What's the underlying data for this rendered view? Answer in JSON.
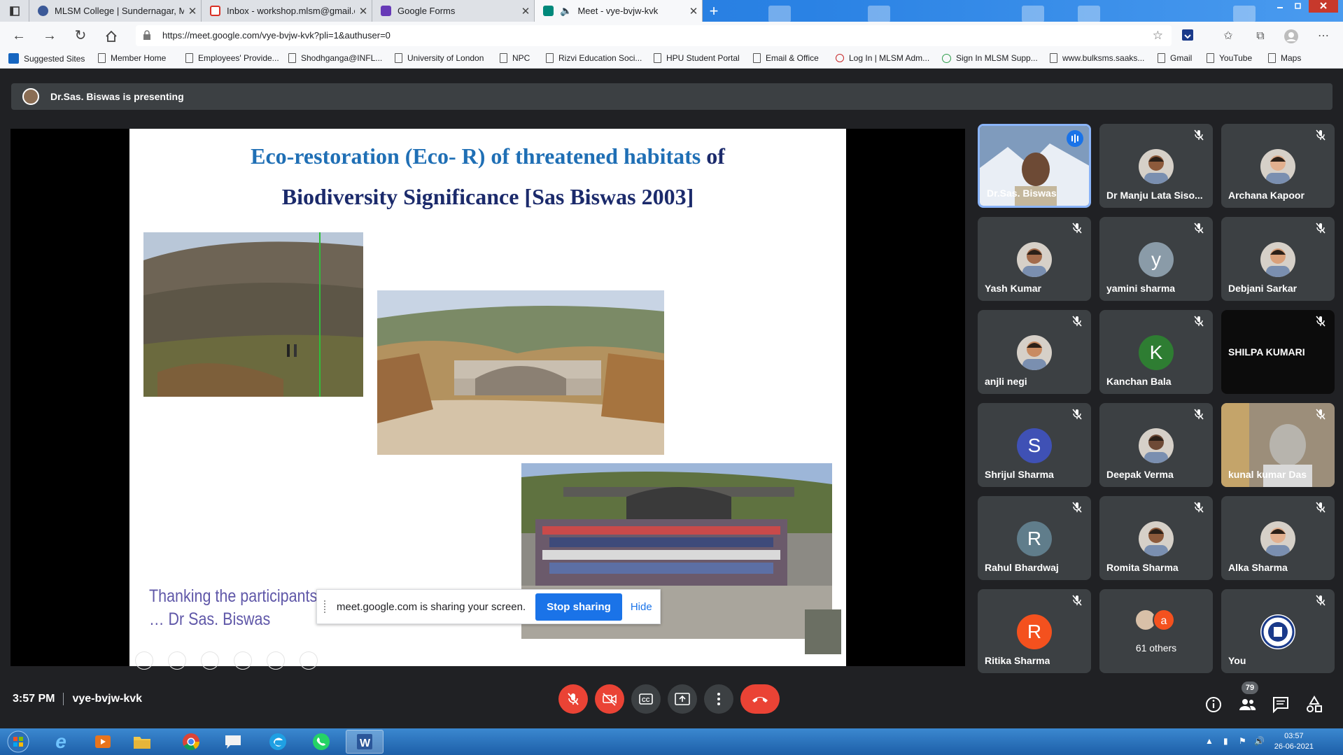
{
  "browser": {
    "tabs": [
      {
        "title": "MLSM College | Sundernagar, M",
        "icon_color": "#3b5998",
        "active": false
      },
      {
        "title": "Inbox - workshop.mlsm@gmail.c",
        "icon_color": "#d93025",
        "active": false
      },
      {
        "title": "Google Forms",
        "icon_color": "#673ab7",
        "active": false
      },
      {
        "title": "Meet - vye-bvjw-kvk",
        "icon_color": "#00897b",
        "active": true
      }
    ],
    "new_tab_glyph": "+",
    "url": "https://meet.google.com/vye-bvjw-kvk?pli=1&authuser=0",
    "bookmarks": [
      {
        "label": "Suggested Sites",
        "icon": "blue"
      },
      {
        "label": "Member Home",
        "icon": "page"
      },
      {
        "label": "Employees' Provide...",
        "icon": "page"
      },
      {
        "label": "Shodhganga@INFL...",
        "icon": "page"
      },
      {
        "label": "University of London",
        "icon": "page"
      },
      {
        "label": "NPC",
        "icon": "page"
      },
      {
        "label": "Rizvi Education Soci...",
        "icon": "page"
      },
      {
        "label": "HPU Student Portal",
        "icon": "page"
      },
      {
        "label": "Email & Office",
        "icon": "page"
      },
      {
        "label": "Log In | MLSM Adm...",
        "icon": "red"
      },
      {
        "label": "Sign In MLSM Supp...",
        "icon": "green"
      },
      {
        "label": "www.bulksms.saaks...",
        "icon": "page"
      },
      {
        "label": "Gmail",
        "icon": "page"
      },
      {
        "label": "YouTube",
        "icon": "page"
      },
      {
        "label": "Maps",
        "icon": "page"
      }
    ]
  },
  "meet": {
    "presenting_text": "Dr.Sas. Biswas is presenting",
    "slide": {
      "title_line1_a": "Eco-restoration  (Eco- R) of threatened habitats",
      "title_line1_b": " of",
      "title_line2": "Biodiversity Significance [Sas Biswas 2003]",
      "thanks_line1": "Thanking the participants a",
      "thanks_line2": "… Dr Sas. Biswas"
    },
    "share_bar": {
      "text": "meet.google.com is sharing your screen.",
      "stop_label": "Stop sharing",
      "hide_label": "Hide"
    },
    "participants": [
      {
        "name": "Dr.Sas. Biswas",
        "kind": "video",
        "speaking": true
      },
      {
        "name": "Dr Manju Lata Siso...",
        "kind": "photo",
        "muted": true
      },
      {
        "name": "Archana Kapoor",
        "kind": "photo",
        "muted": true
      },
      {
        "name": "Yash Kumar",
        "kind": "photo",
        "muted": true
      },
      {
        "name": "yamini sharma",
        "kind": "letter",
        "letter": "y",
        "color": "#8a9ba8",
        "muted": true
      },
      {
        "name": "Debjani Sarkar",
        "kind": "photo",
        "muted": true
      },
      {
        "name": "anjli negi",
        "kind": "photo",
        "muted": true
      },
      {
        "name": "Kanchan Bala",
        "kind": "letter",
        "letter": "K",
        "color": "#2e7d32",
        "muted": true
      },
      {
        "name": "SHILPA KUMARI",
        "kind": "dark",
        "muted": true
      },
      {
        "name": "Shrijul Sharma",
        "kind": "letter",
        "letter": "S",
        "color": "#3f51b5",
        "muted": true
      },
      {
        "name": "Deepak Verma",
        "kind": "photo",
        "muted": true
      },
      {
        "name": "kunal kumar Das",
        "kind": "video",
        "muted": true
      },
      {
        "name": "Rahul Bhardwaj",
        "kind": "letter",
        "letter": "R",
        "color": "#607d8b",
        "muted": true
      },
      {
        "name": "Romita Sharma",
        "kind": "photo",
        "muted": true
      },
      {
        "name": "Alka Sharma",
        "kind": "photo",
        "muted": true
      },
      {
        "name": "Ritika Sharma",
        "kind": "letter",
        "letter": "R",
        "color": "#f4511e",
        "muted": true
      },
      {
        "name": "61 others",
        "kind": "others",
        "letter": "a",
        "color": "#f4511e"
      },
      {
        "name": "You",
        "kind": "emblem",
        "muted": true
      }
    ],
    "time": "3:57 PM",
    "meeting_code": "vye-bvjw-kvk",
    "people_count": "79"
  },
  "taskbar": {
    "time": "03:57",
    "date": "26-06-2021"
  },
  "colors": {
    "mic_off_red": "#ea4335",
    "stop_share_blue": "#1a73e8",
    "meet_bg": "#202124",
    "tile_bg": "#3c4043",
    "slide_title_blue": "#1f6fb5"
  }
}
